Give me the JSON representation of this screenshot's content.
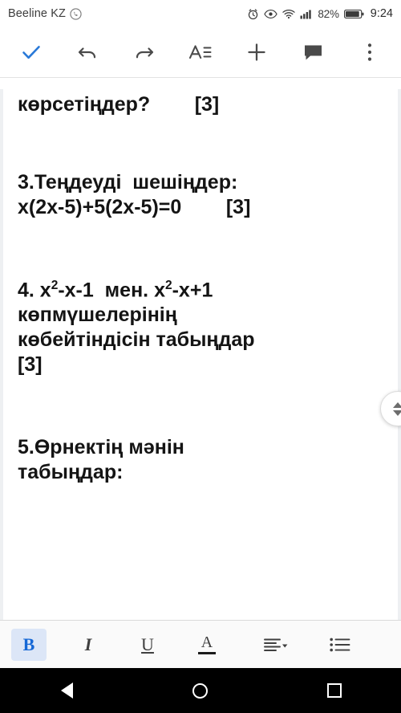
{
  "statusbar": {
    "carrier": "Beeline KZ",
    "battery_percent": "82%",
    "clock": "9:24",
    "icons": [
      "whatsapp-icon",
      "alarm-icon",
      "eye-icon",
      "wifi-icon",
      "signal-icon",
      "battery-icon"
    ]
  },
  "toolbar": {
    "accept_label": "✓",
    "undo_label": "↶",
    "redo_label": "↷",
    "text_format_label": "Aː",
    "insert_label": "+",
    "comment_label": "▤",
    "overflow_label": "⋮",
    "accent_color": "#2979d8"
  },
  "document": {
    "lines": [
      {
        "id": "l0",
        "text": "көрсетіңдер?        [3]"
      },
      {
        "id": "l1",
        "text": "3.Теңдеуді  шешіңдер:"
      },
      {
        "id": "l2",
        "text": "x(2x-5)+5(2x-5)=0        [3]"
      },
      {
        "id": "l3a",
        "text": "4. x"
      },
      {
        "id": "l3sup1",
        "text": "2"
      },
      {
        "id": "l3b",
        "text": "-x-1  мен. x"
      },
      {
        "id": "l3sup2",
        "text": "2"
      },
      {
        "id": "l3c",
        "text": "-x+1"
      },
      {
        "id": "l4",
        "text": "көпмүшелерінің"
      },
      {
        "id": "l5",
        "text": "көбейтіндісін табыңдар"
      },
      {
        "id": "l6",
        "text": "[3]"
      },
      {
        "id": "l7",
        "text": "5.Өрнектің мәнін"
      },
      {
        "id": "l8",
        "text": "табыңдар:"
      }
    ]
  },
  "scroll": {
    "up_label": "▲",
    "down_label": "▼"
  },
  "formatbar": {
    "bold_label": "B",
    "italic_label": "I",
    "underline_label": "U",
    "text_color_label": "A",
    "text_color_swatch": "#1b1b1b",
    "align_label": "≡",
    "align_caret": "▾",
    "list_label": "☰",
    "bold_active": true
  },
  "navbar": {
    "back_label": "back-triangle",
    "home_label": "home-circle",
    "recents_label": "recents-square"
  }
}
